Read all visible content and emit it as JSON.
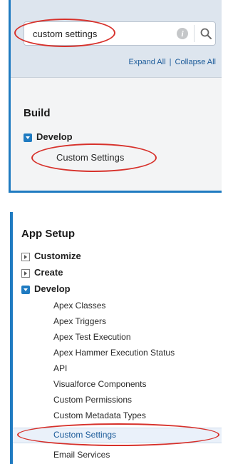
{
  "search": {
    "value": "custom settings",
    "info_glyph": "i",
    "expand_all": "Expand All",
    "separator": "|",
    "collapse_all": "Collapse All"
  },
  "build": {
    "heading": "Build",
    "develop_label": "Develop",
    "custom_settings_label": "Custom Settings"
  },
  "app_setup": {
    "heading": "App Setup",
    "customize_label": "Customize",
    "create_label": "Create",
    "develop_label": "Develop",
    "develop_items": [
      "Apex Classes",
      "Apex Triggers",
      "Apex Test Execution",
      "Apex Hammer Execution Status",
      "API",
      "Visualforce Components",
      "Custom Permissions",
      "Custom Metadata Types",
      "Custom Settings",
      "Email Services"
    ]
  },
  "colors": {
    "accent_blue": "#1f7bc1",
    "link_blue": "#1a5a99",
    "annotation_red": "#d7312b"
  },
  "icons": {
    "search": "magnifier-icon",
    "info": "info-icon",
    "expanded": "expanded-arrow-icon",
    "collapsed": "collapsed-arrow-icon"
  }
}
